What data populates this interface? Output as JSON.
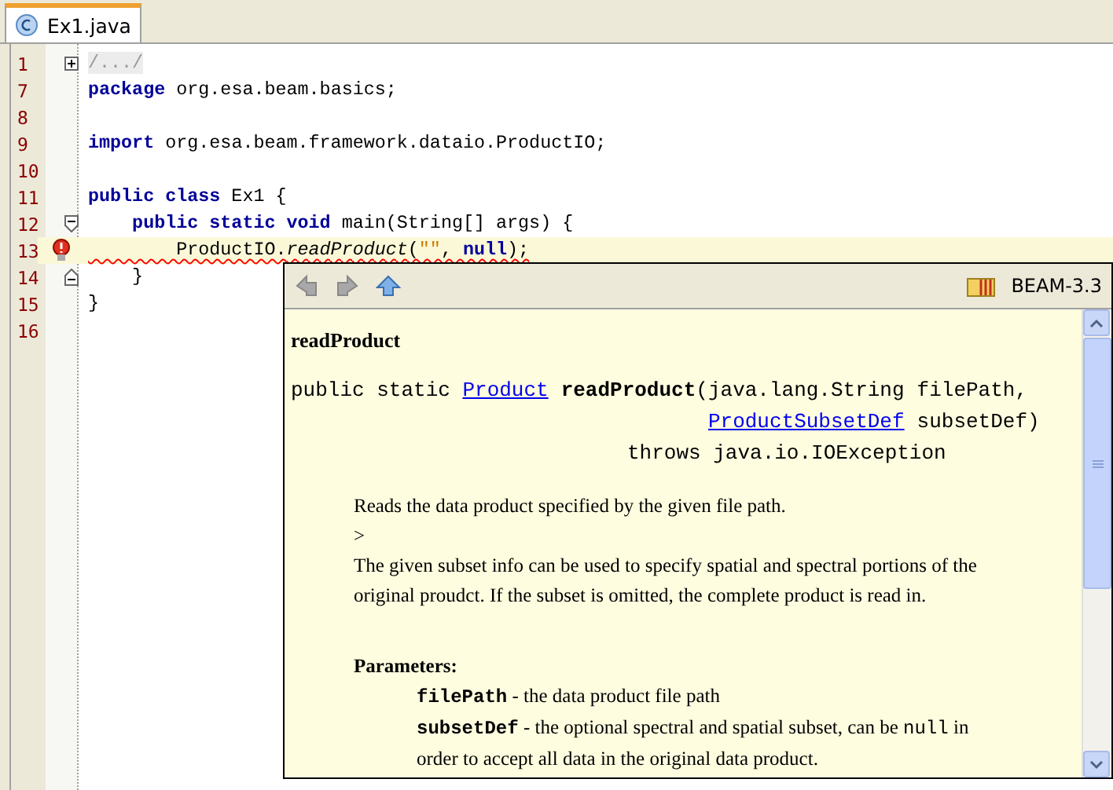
{
  "tabs": [
    {
      "label": "Ex1.java",
      "selected": true
    }
  ],
  "editor": {
    "lines": [
      {
        "number": "1",
        "kind": "folded",
        "error": false,
        "highlighted": false,
        "tokens": [
          {
            "text": "/.../",
            "kind": "folded"
          }
        ]
      },
      {
        "number": "7",
        "kind": "plain",
        "error": false,
        "highlighted": false,
        "tokens": [
          {
            "text": "package",
            "kind": "keyword"
          },
          {
            "text": " org.esa.beam.basics;",
            "kind": "plain"
          }
        ]
      },
      {
        "number": "8",
        "kind": "plain",
        "error": false,
        "highlighted": false
      },
      {
        "number": "9",
        "kind": "plain",
        "error": false,
        "highlighted": false,
        "tokens": [
          {
            "text": "import",
            "kind": "keyword"
          },
          {
            "text": " org.esa.beam.framework.dataio.ProductIO;",
            "kind": "plain"
          }
        ]
      },
      {
        "number": "10",
        "kind": "plain",
        "error": false,
        "highlighted": false
      },
      {
        "number": "11",
        "kind": "plain",
        "error": false,
        "highlighted": false,
        "tokens": [
          {
            "text": "public class",
            "kind": "keyword"
          },
          {
            "text": " Ex1 {",
            "kind": "plain"
          }
        ]
      },
      {
        "number": "12",
        "kind": "foldstart",
        "error": false,
        "highlighted": false,
        "tokens": [
          {
            "text": "    public static void",
            "kind": "keyword"
          },
          {
            "text": " main(String[] args) {",
            "kind": "plain"
          }
        ]
      },
      {
        "number": "13",
        "kind": "plain",
        "error": true,
        "highlighted": true,
        "tokens": [
          {
            "text": "        ProductIO.",
            "kind": "error"
          },
          {
            "text": "readProduct",
            "kind": "error-italic"
          },
          {
            "text": "(",
            "kind": "error"
          },
          {
            "text": "\"\"",
            "kind": "error-string"
          },
          {
            "text": ", ",
            "kind": "error"
          },
          {
            "text": "null",
            "kind": "error-keyword"
          },
          {
            "text": ");",
            "kind": "error"
          }
        ]
      },
      {
        "number": "14",
        "kind": "foldend",
        "error": false,
        "highlighted": false,
        "tokens": [
          {
            "text": "    }",
            "kind": "plain"
          }
        ]
      },
      {
        "number": "15",
        "kind": "plain",
        "error": false,
        "highlighted": false,
        "tokens": [
          {
            "text": "}",
            "kind": "plain"
          }
        ]
      },
      {
        "number": "16",
        "kind": "plain",
        "error": false,
        "highlighted": false
      }
    ]
  },
  "doc_popup": {
    "library": "BEAM-3.3",
    "heading": "readProduct",
    "signature": {
      "prefix": "public static ",
      "return_type": "Product",
      "name": "readProduct",
      "open_paren": "(",
      "params": [
        {
          "type": "java.lang.String",
          "name": "filePath,",
          "link": false
        },
        {
          "type": "ProductSubsetDef",
          "name": "subsetDef)",
          "link": true
        }
      ],
      "throws": "throws java.io.IOException"
    },
    "description": [
      "Reads the data product specified by the given file path.",
      ">",
      "The given subset info can be used to specify spatial and spectral portions of the original proudct.  If the subset is omitted, the complete product is read in."
    ],
    "parameters_label": "Parameters:",
    "parameters": [
      {
        "name": "filePath",
        "text": " - the data product file path"
      },
      {
        "name": "subsetDef",
        "text": " - the optional spectral and spatial subset, can be ",
        "code": "null",
        "text_end": " in order to accept all data in the original data product."
      }
    ]
  }
}
